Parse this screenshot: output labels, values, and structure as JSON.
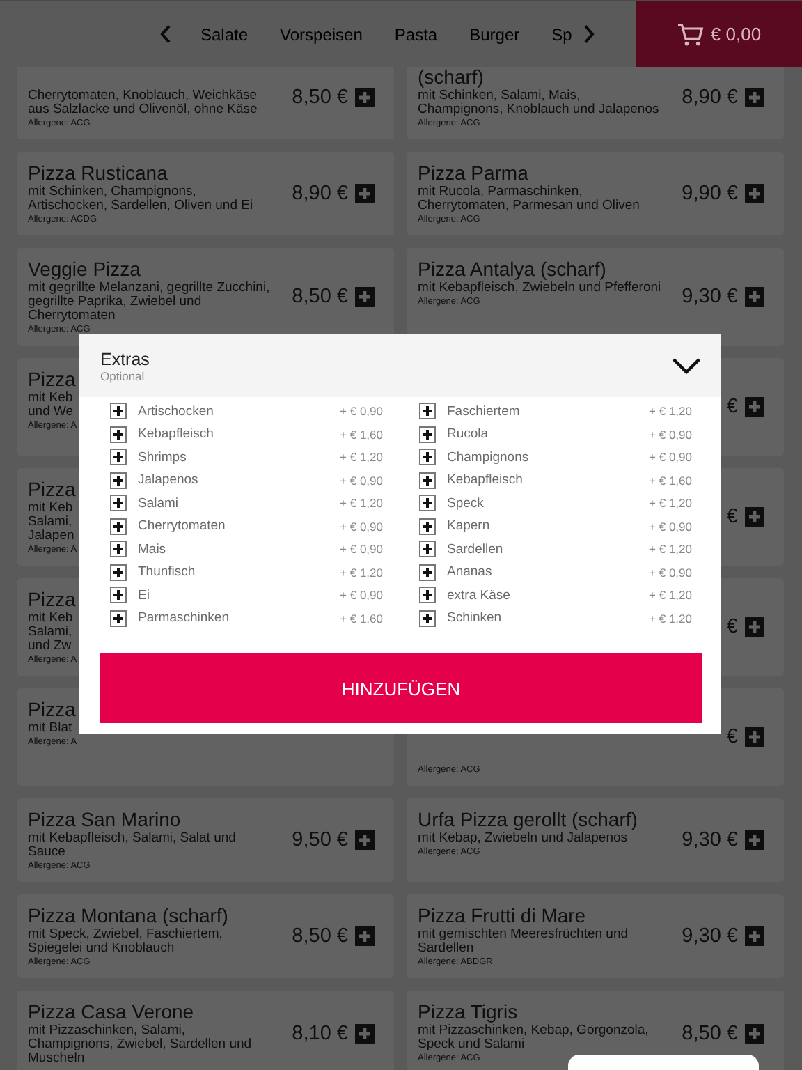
{
  "nav": {
    "categories": [
      {
        "label": "Salate"
      },
      {
        "label": "Vorspeisen"
      },
      {
        "label": "Pasta"
      },
      {
        "label": "Burger"
      },
      {
        "label": "Sp"
      }
    ],
    "cart_total": "€ 0,00"
  },
  "menu": [
    {
      "kind": "full",
      "desc": "Cherrytomaten, Knoblauch, Weichkäse aus Salzlacke und Olivenöl, ohne Käse",
      "allergens": "Allergene: ACG",
      "price": "8,50 €"
    },
    {
      "kind": "full",
      "name": "(scharf)",
      "desc": "mit Schinken, Salami, Mais, Champignons, Knoblauch und Jalapenos",
      "allergens": "Allergene: ACG",
      "price": "8,90 €"
    },
    {
      "kind": "full",
      "name": "Pizza Rusticana",
      "desc": "mit Schinken, Champignons, Artischocken, Sardellen, Oliven und Ei",
      "allergens": "Allergene: ACDG",
      "price": "8,90 €"
    },
    {
      "kind": "full",
      "name": "Pizza Parma",
      "desc": "mit Rucola, Parmaschinken, Cherrytomaten, Parmesan und Oliven",
      "allergens": "Allergene: ACG",
      "price": "9,90 €"
    },
    {
      "kind": "full",
      "name": "Veggie Pizza",
      "desc": "mit gegrillte Melanzani, gegrillte Zucchini, gegrillte Paprika, Zwiebel und Cherrytomaten",
      "allergens": "Allergene: ACG",
      "price": "8,50 €"
    },
    {
      "kind": "full",
      "name": "Pizza Antalya (scharf)",
      "desc": "mit Kebapfleisch, Zwiebeln und Pfefferoni",
      "allergens": "Allergene: ACG",
      "price": "9,30 €"
    },
    {
      "kind": "covered_left",
      "name": "Pizza",
      "lines": [
        "mit Keb",
        "und We"
      ],
      "allergens": "Allergene: A"
    },
    {
      "kind": "covered_right",
      "price": "€"
    },
    {
      "kind": "covered_left",
      "name": "Pizza",
      "lines": [
        "mit Keb",
        "Salami,",
        "Jalapen"
      ],
      "allergens": "Allergene: A"
    },
    {
      "kind": "covered_right",
      "price": "€"
    },
    {
      "kind": "covered_left",
      "name": "Pizza",
      "lines": [
        "mit Keb",
        "Salami,",
        "und Zw"
      ],
      "allergens": "Allergene: A"
    },
    {
      "kind": "covered_right",
      "price": "€"
    },
    {
      "kind": "covered_left",
      "name": "Pizza",
      "lines": [
        "mit Blat"
      ],
      "allergens": "Allergene: A"
    },
    {
      "kind": "covered_right",
      "price": "€",
      "allergens": "Allergene: ACG"
    },
    {
      "kind": "full",
      "name": "Pizza San Marino",
      "desc": "mit Kebapfleisch, Salami, Salat und Sauce",
      "allergens": "Allergene: ACG",
      "price": "9,50 €"
    },
    {
      "kind": "full",
      "name": "Urfa Pizza gerollt (scharf)",
      "desc": "mit Kebap, Zwiebeln und Jalapenos",
      "allergens": "Allergene: ACG",
      "price": "9,30 €"
    },
    {
      "kind": "full",
      "name": "Pizza Montana (scharf)",
      "desc": "mit Speck, Zwiebel, Faschiertem, Spiegelei und Knoblauch",
      "allergens": "Allergene: ACG",
      "price": "8,50 €"
    },
    {
      "kind": "full",
      "name": "Pizza Frutti di Mare",
      "desc": "mit gemischten Meeresfrüchten und Sardellen",
      "allergens": "Allergene: ABDGR",
      "price": "9,30 €"
    },
    {
      "kind": "full",
      "name": "Pizza Casa Verone",
      "desc": "mit Pizzaschinken, Salami, Champignons, Zwiebel, Sardellen und Muscheln",
      "price": "8,10 €"
    },
    {
      "kind": "full",
      "name": "Pizza Tigris",
      "desc": "mit Pizzaschinken, Kebap, Gorgonzola, Speck und Salami",
      "allergens": "Allergene: ACG",
      "price": "8,50 €"
    }
  ],
  "modal": {
    "title": "Extras",
    "subtitle": "Optional",
    "columns": [
      [
        {
          "name": "Artischocken",
          "price": "+ € 0,90"
        },
        {
          "name": "Kebapfleisch",
          "price": "+ € 1,60"
        },
        {
          "name": "Shrimps",
          "price": "+ € 1,20"
        },
        {
          "name": "Jalapenos",
          "price": "+ € 0,90"
        },
        {
          "name": "Salami",
          "price": "+ € 1,20"
        },
        {
          "name": "Cherrytomaten",
          "price": "+ € 0,90"
        },
        {
          "name": "Mais",
          "price": "+ € 0,90"
        },
        {
          "name": "Thunfisch",
          "price": "+ € 1,20"
        },
        {
          "name": "Ei",
          "price": "+ € 0,90"
        },
        {
          "name": "Parmaschinken",
          "price": "+ € 1,60"
        }
      ],
      [
        {
          "name": "Faschiertem",
          "price": "+ € 1,20"
        },
        {
          "name": "Rucola",
          "price": "+ € 0,90"
        },
        {
          "name": "Champignons",
          "price": "+ € 0,90"
        },
        {
          "name": "Kebapfleisch",
          "price": "+ € 1,60"
        },
        {
          "name": "Speck",
          "price": "+ € 1,20"
        },
        {
          "name": "Kapern",
          "price": "+ € 0,90"
        },
        {
          "name": "Sardellen",
          "price": "+ € 1,20"
        },
        {
          "name": "Ananas",
          "price": "+ € 0,90"
        },
        {
          "name": "extra Käse",
          "price": "+ € 1,20"
        },
        {
          "name": "Schinken",
          "price": "+ € 1,20"
        }
      ]
    ],
    "button": "HINZUFÜGEN"
  }
}
